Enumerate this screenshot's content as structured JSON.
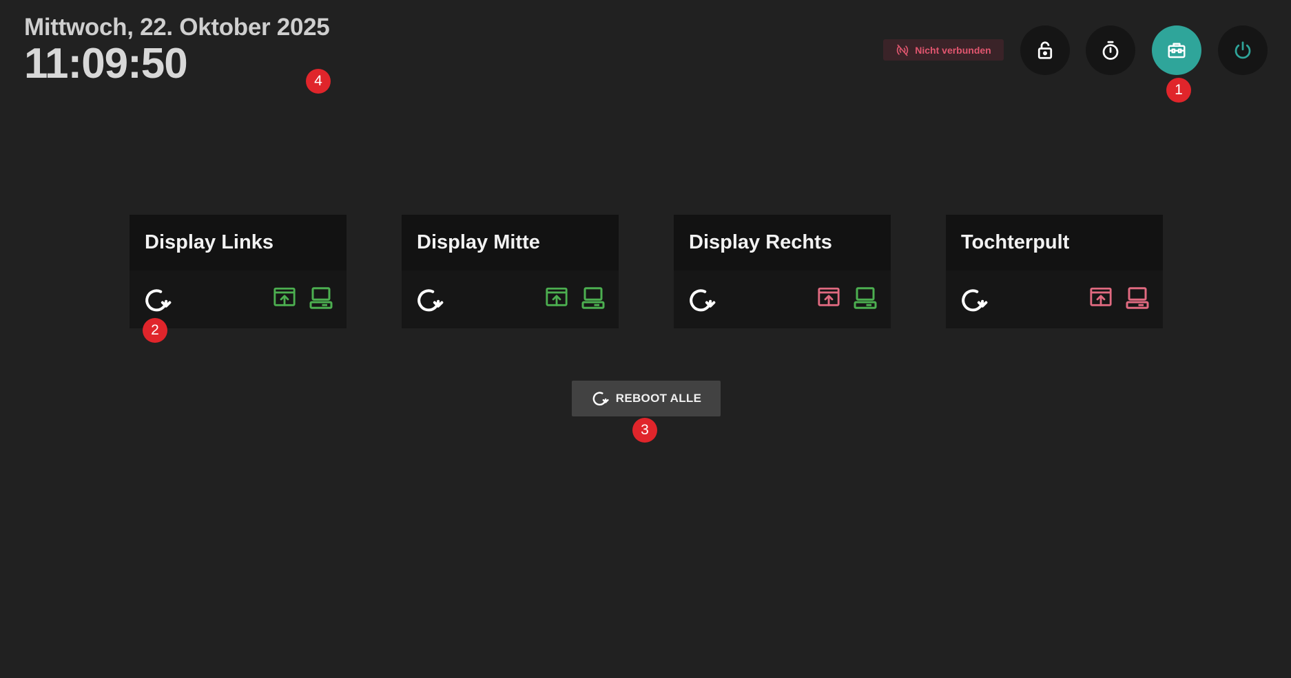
{
  "header": {
    "date": "Mittwoch, 22. Oktober 2025",
    "time": "11:09:50"
  },
  "status": {
    "label": "Nicht verbunden",
    "icon": "signal-off-icon",
    "color": "#e1566f"
  },
  "toolbar": {
    "buttons": [
      {
        "name": "lock",
        "icon": "lock-icon"
      },
      {
        "name": "timer",
        "icon": "stopwatch-icon"
      },
      {
        "name": "tools",
        "icon": "toolbox-icon",
        "active": true
      },
      {
        "name": "power",
        "icon": "power-icon"
      }
    ],
    "accent": "#2fa59a"
  },
  "displays": [
    {
      "title": "Display Links",
      "cast_status": "ok",
      "device_status": "ok"
    },
    {
      "title": "Display Mitte",
      "cast_status": "ok",
      "device_status": "ok"
    },
    {
      "title": "Display Rechts",
      "cast_status": "error",
      "device_status": "ok"
    },
    {
      "title": "Tochterpult",
      "cast_status": "error",
      "device_status": "error"
    }
  ],
  "status_colors": {
    "ok": "#4caf50",
    "error": "#e06a80"
  },
  "reboot_all": {
    "label": "REBOOT ALLE",
    "icon": "refresh-icon"
  },
  "markers": [
    "1",
    "2",
    "3",
    "4"
  ]
}
